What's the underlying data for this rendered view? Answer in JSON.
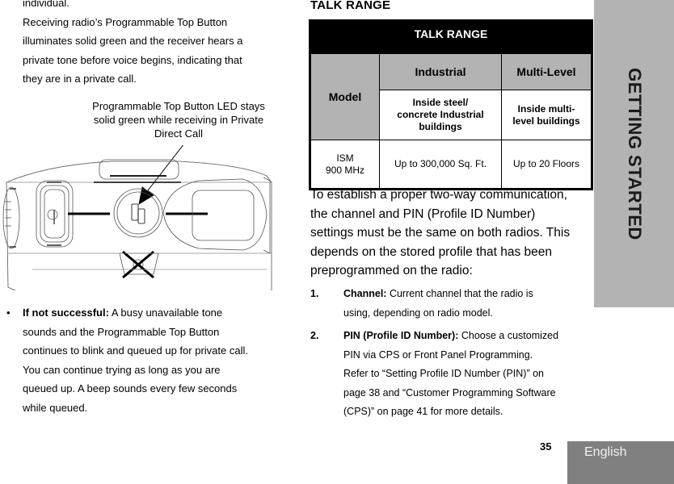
{
  "left_column": {
    "intro_lines": [
      "individual.",
      "Receiving radio’s Programmable Top Button",
      "illuminates solid green and the receiver hears a",
      "private tone before voice begins, indicating that",
      "they are in a private call."
    ],
    "figure_caption_lines": [
      "Programmable Top Button LED stays",
      "solid green while receiving in Private",
      "Direct Call"
    ],
    "figure": {
      "description": "Top view of radio with Programmable Top Button highlighted",
      "icons": [
        "power-button",
        "programmable-top-button",
        "antenna-marker"
      ]
    },
    "bullet": {
      "marker": "•",
      "bold_label": "If not successful:",
      "first_line_rest": " A busy unavailable tone",
      "lines": [
        "sounds and the Programmable Top Button",
        "continues to blink and queued up for private call.",
        "You can continue trying as long as you are",
        "queued up. A beep sounds every few seconds",
        "while queued."
      ]
    }
  },
  "right_column": {
    "section_heading": "TALK RANGE",
    "table": {
      "title": "TALK RANGE",
      "model_header": "Model",
      "categories": [
        "Industrial",
        "Multi-Level"
      ],
      "descriptions": [
        [
          "Inside steel/",
          "concrete Industrial",
          "buildings"
        ],
        [
          "Inside multi-",
          "level buildings"
        ]
      ],
      "rows": [
        {
          "model_lines": [
            "ISM",
            "900 MHz"
          ],
          "industrial": "Up to 300,000 Sq. Ft.",
          "multi_level": "Up to 20 Floors"
        }
      ]
    },
    "paragraph_lines": [
      "To establish a proper two-way communication,",
      "the channel and PIN (Profile ID Number)",
      "settings must be the same on both radios. This",
      "depends on the stored profile that has been",
      "preprogrammed on the radio:"
    ],
    "numbered_items": [
      {
        "number": "1.",
        "bold_label": "Channel:",
        "first_line_rest": " Current channel that the radio is",
        "lines": [
          "using, depending on radio model."
        ]
      },
      {
        "number": "2.",
        "bold_label": "PIN (Profile ID Number):",
        "first_line_rest": " Choose a customized",
        "lines": [
          "PIN via CPS or Front Panel Programming.",
          "Refer to “Setting Profile ID Number (PIN)” on",
          "page 38 and “Customer Programming Software",
          "(CPS)” on page 41 for more details."
        ]
      }
    ]
  },
  "side_tab": {
    "label": "GETTING STARTED",
    "color": "#b3b3b3"
  },
  "footer": {
    "page_number": "35",
    "language": "English",
    "language_tab_color": "#808080"
  }
}
